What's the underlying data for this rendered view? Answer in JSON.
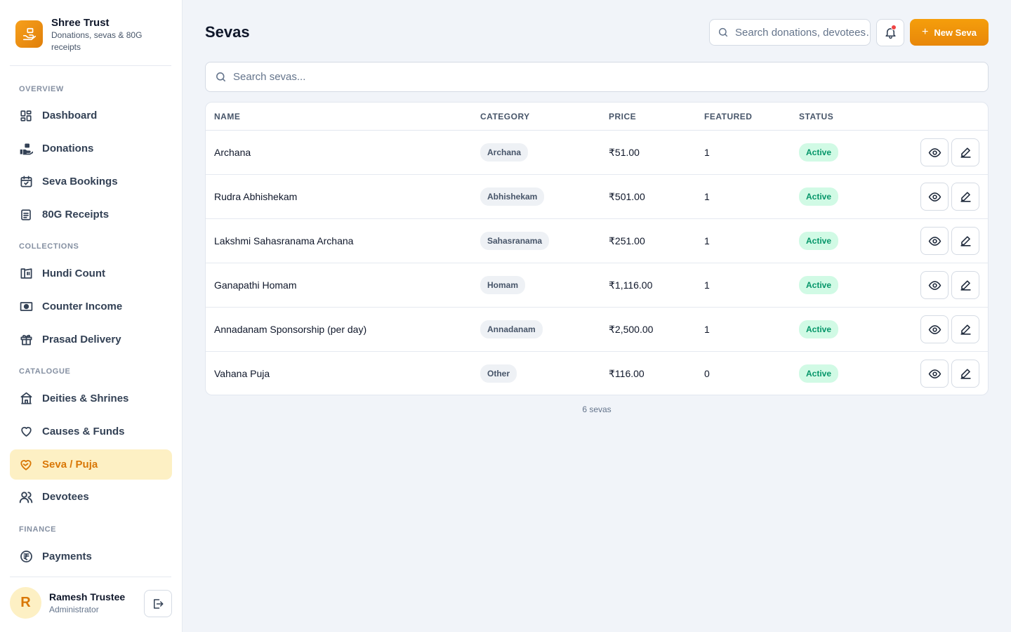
{
  "brand": {
    "title": "Shree Trust",
    "subtitle": "Donations, sevas & 80G receipts"
  },
  "sidebar": {
    "sections": [
      {
        "label": "OVERVIEW"
      },
      {
        "label": "COLLECTIONS"
      },
      {
        "label": "CATALOGUE"
      },
      {
        "label": "FINANCE"
      }
    ],
    "items": [
      {
        "label": "Dashboard",
        "icon": "dashboard-icon"
      },
      {
        "label": "Donations",
        "icon": "donation-hand-icon"
      },
      {
        "label": "Seva Bookings",
        "icon": "calendar-check-icon"
      },
      {
        "label": "80G Receipts",
        "icon": "receipt-icon"
      },
      {
        "label": "Hundi Count",
        "icon": "hundi-box-icon"
      },
      {
        "label": "Counter Income",
        "icon": "cash-icon"
      },
      {
        "label": "Prasad Delivery",
        "icon": "gift-icon"
      },
      {
        "label": "Deities & Shrines",
        "icon": "temple-icon"
      },
      {
        "label": "Causes & Funds",
        "icon": "heart-icon"
      },
      {
        "label": "Seva / Puja",
        "icon": "heart-hand-icon",
        "active": true
      },
      {
        "label": "Devotees",
        "icon": "users-icon"
      },
      {
        "label": "Payments",
        "icon": "rupee-circle-icon"
      }
    ]
  },
  "user": {
    "initial": "R",
    "name": "Ramesh Trustee",
    "role": "Administrator"
  },
  "header": {
    "title": "Sevas",
    "search_placeholder": "Search donations, devotees…",
    "new_button_label": "New Seva"
  },
  "list": {
    "search_placeholder": "Search sevas...",
    "columns": [
      "NAME",
      "CATEGORY",
      "PRICE",
      "FEATURED",
      "STATUS"
    ],
    "rows": [
      {
        "name": "Archana",
        "category": "Archana",
        "price": "₹51.00",
        "featured": "1",
        "status": "Active"
      },
      {
        "name": "Rudra Abhishekam",
        "category": "Abhishekam",
        "price": "₹501.00",
        "featured": "1",
        "status": "Active"
      },
      {
        "name": "Lakshmi Sahasranama Archana",
        "category": "Sahasranama",
        "price": "₹251.00",
        "featured": "1",
        "status": "Active"
      },
      {
        "name": "Ganapathi Homam",
        "category": "Homam",
        "price": "₹1,116.00",
        "featured": "1",
        "status": "Active"
      },
      {
        "name": "Annadanam Sponsorship (per day)",
        "category": "Annadanam",
        "price": "₹2,500.00",
        "featured": "1",
        "status": "Active"
      },
      {
        "name": "Vahana Puja",
        "category": "Other",
        "price": "₹116.00",
        "featured": "0",
        "status": "Active"
      }
    ],
    "count_label": "6 sevas"
  },
  "colors": {
    "accent": "#f59e0b",
    "active_bg": "#fdf0c4",
    "status_active": "#059669"
  }
}
